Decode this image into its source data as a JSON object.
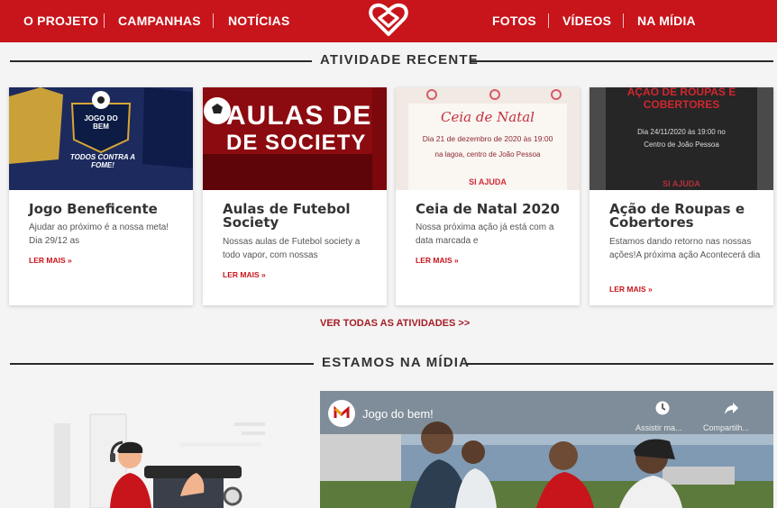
{
  "nav": {
    "left_items": [
      "O PROJETO",
      "CAMPANHAS",
      "NOTÍCIAS"
    ],
    "right_items": [
      "FOTOS",
      "VÍDEOS",
      "NA MÍDIA"
    ]
  },
  "sections": {
    "recent": "ATIVIDADE RECENTE",
    "media": "ESTAMOS NA MÍDIA"
  },
  "cards": [
    {
      "title": "Jogo Beneficente",
      "excerpt": "Ajudar ao próximo é a nossa meta! Dia 29/12 as",
      "read_more": "LER MAIS »",
      "image": {
        "heading": "JOGO DO BEM",
        "tagline": "TODOS CONTRA A FOME!"
      }
    },
    {
      "title": "Aulas de Futebol Society",
      "excerpt": "Nossas aulas de Futebol society a todo vapor, com nossas",
      "read_more": "LER MAIS »",
      "image": {
        "line1": "AULAS DE",
        "line2": "DE SOCIETY"
      }
    },
    {
      "title": "Ceia de Natal 2020",
      "excerpt": "Nossa próxima ação já está com a data marcada e",
      "read_more": "LER MAIS »",
      "image": {
        "heading": "Ceia de Natal",
        "line1": "Dia 21 de dezembro de 2020 às 19:00",
        "line2": "na lagoa, centro de João Pessoa"
      }
    },
    {
      "title": "Ação de Roupas e Cobertores",
      "excerpt": "Estamos dando retorno nas nossas ações!A próxima ação Acontecerá dia",
      "read_more": "LER MAIS »",
      "image": {
        "heading1": "AÇÃO DE ROUPAS E",
        "heading2": "COBERTORES",
        "line1": "Dia 24/11/2020 às 19:00 no",
        "line2": "Centro de João Pessoa"
      }
    }
  ],
  "all_activities": "VER TODAS AS ATIVIDADES >>",
  "video": {
    "title": "Jogo do bem!",
    "watch_later": "Assistir ma...",
    "share": "Compartilh..."
  },
  "colors": {
    "brand_red": "#c8141b",
    "link_red": "#a51c24"
  }
}
